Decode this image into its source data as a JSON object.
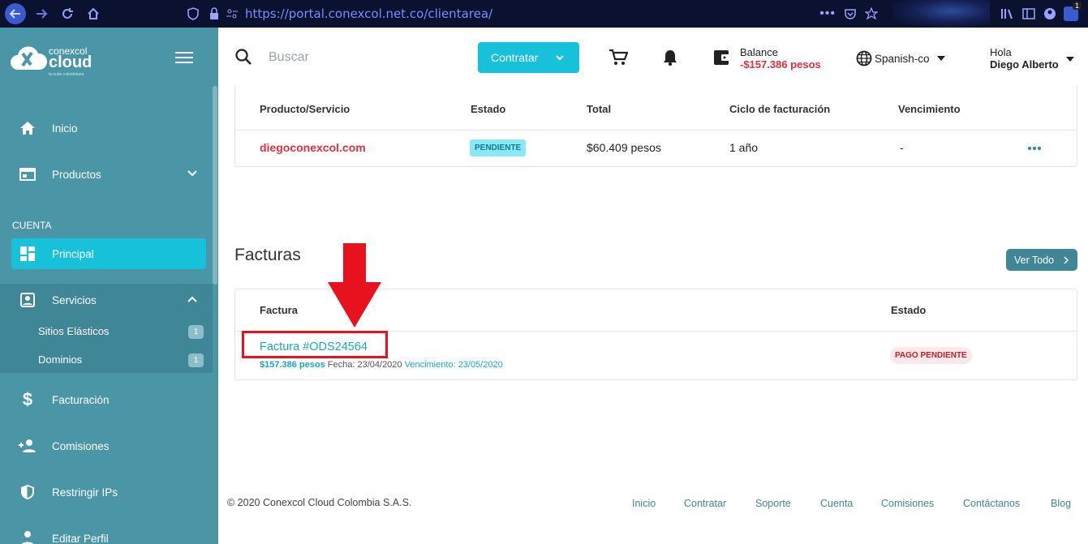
{
  "browser": {
    "url": "https://portal.conexcol.net.co/clientarea/",
    "notification_count": "1"
  },
  "sidebar": {
    "logo": {
      "line1": "conexcol",
      "line2": "cloud",
      "tagline": "la nube colombiana"
    },
    "items": [
      {
        "label": "Inicio"
      },
      {
        "label": "Productos"
      },
      {
        "label": "Principal"
      },
      {
        "label": "Servicios"
      },
      {
        "label": "Facturación"
      },
      {
        "label": "Comisiones"
      },
      {
        "label": "Restringir IPs"
      },
      {
        "label": "Editar Perfil"
      }
    ],
    "section_label": "CUENTA",
    "submenu": [
      {
        "label": "Sitios Elásticos",
        "count": "1"
      },
      {
        "label": "Dominios",
        "count": "1"
      }
    ]
  },
  "topbar": {
    "search_placeholder": "Buscar",
    "contratar_label": "Contratar",
    "balance_label": "Balance",
    "balance_value": "-$157.386 pesos",
    "language": "Spanish-co",
    "greeting": "Hola",
    "user_name": "Diego Alberto"
  },
  "services": {
    "headers": [
      "Producto/Servicio",
      "Estado",
      "Total",
      "Ciclo de facturación",
      "Vencimiento"
    ],
    "rows": [
      {
        "product": "diegoconexcol.com",
        "status": "PENDIENTE",
        "total": "$60.409 pesos",
        "cycle": "1 año",
        "due": "-"
      }
    ]
  },
  "invoices": {
    "title": "Facturas",
    "view_all": "Ver Todo",
    "headers": [
      "Factura",
      "Estado"
    ],
    "rows": [
      {
        "name": "Factura #ODS24564",
        "amount": "$157.386 pesos",
        "date": "Fecha: 23/04/2020",
        "due": "Vencimiento: 23/05/2020",
        "status": "PAGO PENDIENTE"
      }
    ]
  },
  "footer": {
    "copyright": "© 2020 Conexcol Cloud Colombia S.A.S.",
    "links": [
      "Inicio",
      "Contratar",
      "Soporte",
      "Cuenta",
      "Comisiones",
      "Contáctanos",
      "Blog"
    ]
  },
  "colors": {
    "sidebar": "#4a96a6",
    "accent": "#17c1da",
    "danger": "#e0303e",
    "annotation": "#e8121f"
  }
}
